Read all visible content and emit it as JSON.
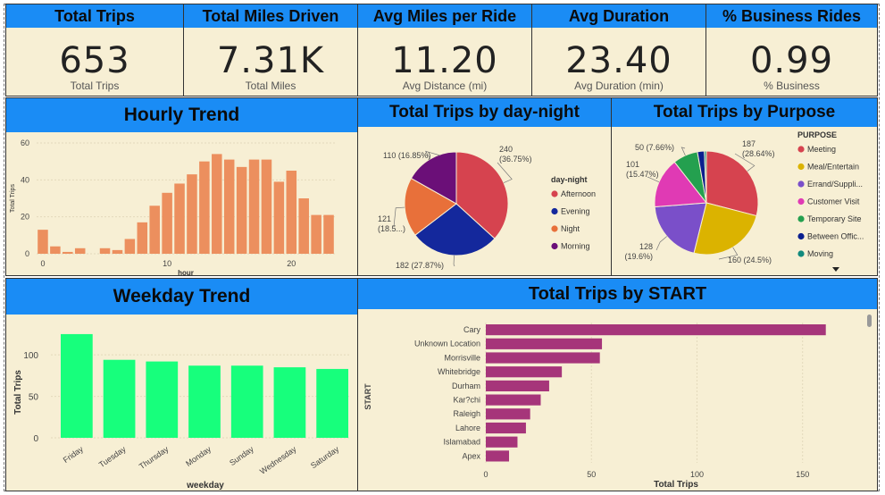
{
  "kpis": [
    {
      "title": "Total Trips",
      "value": "653",
      "label": "Total Trips"
    },
    {
      "title": "Total Miles Driven",
      "value": "7.31K",
      "label": "Total Miles"
    },
    {
      "title": "Avg Miles per Ride",
      "value": "11.20",
      "label": "Avg Distance (mi)"
    },
    {
      "title": "Avg Duration",
      "value": "23.40",
      "label": "Avg Duration (min)"
    },
    {
      "title": "% Business Rides",
      "value": "0.99",
      "label": "% Business"
    }
  ],
  "colors": {
    "header": "#1a8cf5",
    "panel": "#f7efd4",
    "hourly_bar": "#ec8f5e",
    "weekday_bar": "#17ff7c",
    "start_bar": "#a6357a"
  },
  "chart_data": [
    {
      "id": "hourly",
      "type": "bar",
      "title": "Hourly Trend",
      "xlabel": "hour",
      "ylabel": "Total Trips",
      "x": [
        0,
        1,
        2,
        3,
        4,
        5,
        6,
        7,
        8,
        9,
        10,
        11,
        12,
        13,
        14,
        15,
        16,
        17,
        18,
        19,
        20,
        21,
        22,
        23
      ],
      "values": [
        13,
        4,
        1,
        3,
        0,
        3,
        2,
        8,
        17,
        26,
        33,
        38,
        43,
        50,
        54,
        51,
        47,
        51,
        51,
        39,
        45,
        30,
        21,
        21
      ],
      "ylim": [
        0,
        60
      ],
      "yticks": [
        0,
        20,
        40,
        60
      ],
      "xticks": [
        0,
        10,
        20
      ]
    },
    {
      "id": "daynight",
      "type": "pie",
      "title": "Total Trips by day-night",
      "legend_title": "day-night",
      "categories": [
        "Afternoon",
        "Evening",
        "Night",
        "Morning"
      ],
      "values": [
        240,
        182,
        121,
        110
      ],
      "labels": [
        "240 (36.75%)",
        "182 (27.87%)",
        "121 (18.5...)",
        "110 (16.85%)"
      ],
      "colors": [
        "#d6434f",
        "#14289c",
        "#e8703a",
        "#6b0f78"
      ]
    },
    {
      "id": "purpose",
      "type": "pie",
      "title": "Total Trips by Purpose",
      "legend_title": "PURPOSE",
      "categories": [
        "Meeting",
        "Meal/Entertain",
        "Errand/Suppli...",
        "Customer Visit",
        "Temporary Site",
        "Between Offic...",
        "Moving"
      ],
      "values": [
        187,
        160,
        128,
        101,
        50,
        14,
        4
      ],
      "labels": [
        "187 (28.64%)",
        "160 (24.5%)",
        "128 (19.6%)",
        "101 (15.47%)",
        "50 (7.66%)"
      ],
      "colors": [
        "#d6434f",
        "#dbb300",
        "#7a4fc9",
        "#e03ab4",
        "#24a04f",
        "#0a1f8f",
        "#128a7d"
      ]
    },
    {
      "id": "weekday",
      "type": "bar",
      "title": "Weekday Trend",
      "xlabel": "weekday",
      "ylabel": "Total Trips",
      "categories": [
        "Friday",
        "Tuesday",
        "Thursday",
        "Monday",
        "Sunday",
        "Wednesday",
        "Saturday"
      ],
      "values": [
        125,
        94,
        92,
        87,
        87,
        85,
        83
      ],
      "ylim": [
        0,
        140
      ],
      "yticks": [
        0,
        50,
        100
      ]
    },
    {
      "id": "start",
      "type": "bar",
      "orientation": "horizontal",
      "title": "Total Trips by START",
      "xlabel": "Total Trips",
      "ylabel": "START",
      "categories": [
        "Cary",
        "Unknown Location",
        "Morrisville",
        "Whitebridge",
        "Durham",
        "Kar?chi",
        "Raleigh",
        "Lahore",
        "Islamabad",
        "Apex"
      ],
      "values": [
        161,
        55,
        54,
        36,
        30,
        26,
        21,
        19,
        15,
        11
      ],
      "xlim": [
        0,
        170
      ],
      "xticks": [
        0,
        50,
        100,
        150
      ]
    }
  ]
}
